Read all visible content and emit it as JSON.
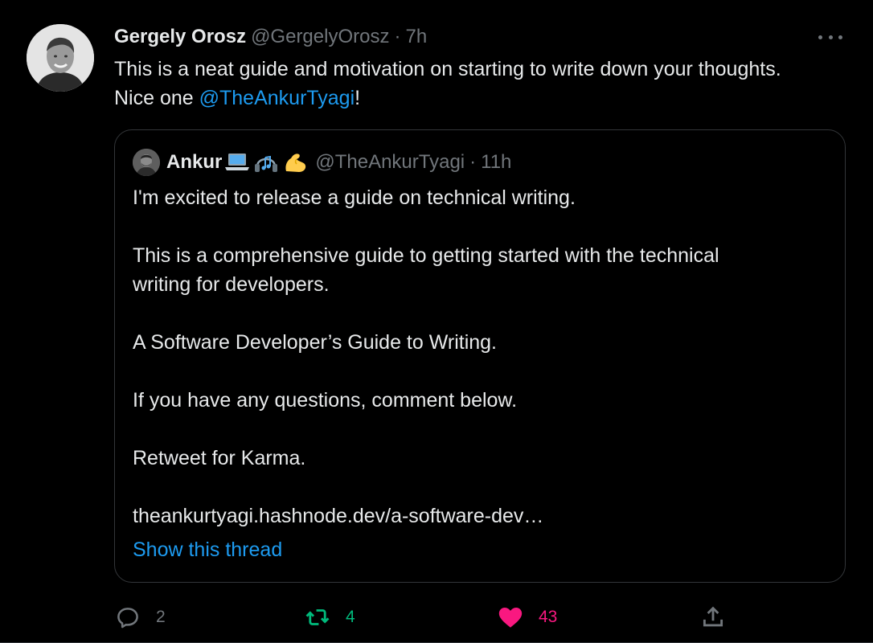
{
  "author": {
    "display_name": "Gergely Orosz",
    "handle": "@GergelyOrosz",
    "separator": "·",
    "time": "7h"
  },
  "tweet": {
    "text_line1": "This is a neat guide and motivation on starting to write down your thoughts.",
    "text_prefix2": "Nice one ",
    "mention": "@TheAnkurTyagi",
    "text_suffix2": "!"
  },
  "quote": {
    "display_name": "Ankur",
    "emojis": [
      "laptop-emoji",
      "headphone-emoji",
      "flexed-biceps-emoji"
    ],
    "handle": "@TheAnkurTyagi",
    "separator": "·",
    "time": "11h",
    "lines": [
      "I'm excited to release a guide on technical writing.",
      "",
      "This is a comprehensive guide to getting started with the technical",
      "writing for developers.",
      "",
      "A Software Developer’s Guide to Writing.",
      "",
      "If you have any questions, comment below.",
      "",
      "Retweet for Karma.",
      "",
      "theankurtyagi.hashnode.dev/a-software-dev…"
    ],
    "show_thread": "Show this thread"
  },
  "actions": {
    "reply_icon": "reply-icon",
    "reply_count": "2",
    "retweet_icon": "retweet-icon",
    "retweet_count": "4",
    "like_icon": "heart-icon",
    "like_count": "43",
    "share_icon": "share-icon"
  },
  "colors": {
    "background": "#000000",
    "text": "#e7e9ea",
    "secondary": "#71767b",
    "link": "#1d9bf0",
    "retweet": "#00ba7c",
    "like": "#f91880",
    "border": "#333639"
  }
}
